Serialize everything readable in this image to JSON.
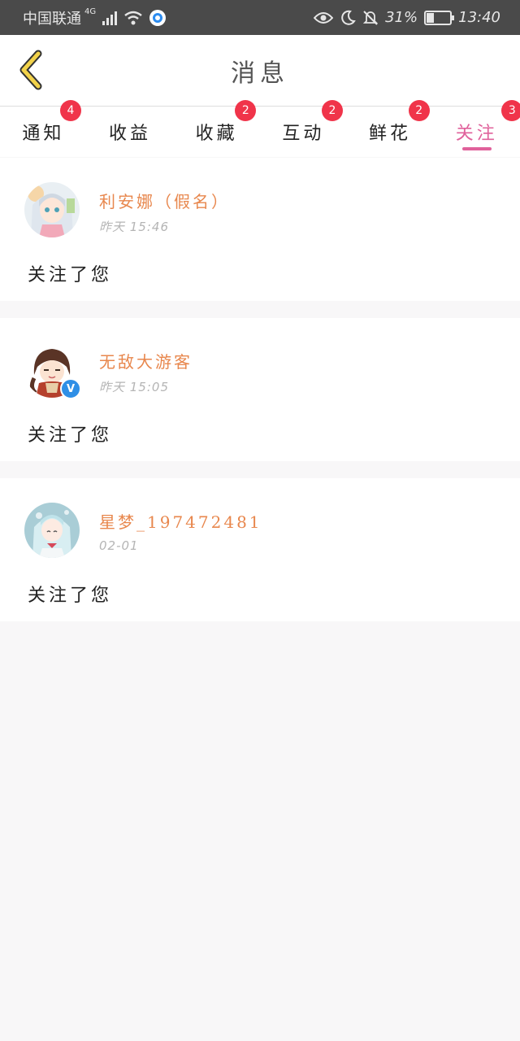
{
  "status_bar": {
    "carrier": "中国联通",
    "network": "4G",
    "battery_percent": "31%",
    "battery_level": 0.31,
    "time": "13:40",
    "icons": [
      "signal-icon",
      "wifi-icon",
      "app-icon",
      "eye-icon",
      "moon-icon",
      "mute-icon",
      "battery-icon"
    ]
  },
  "header": {
    "title": "消息",
    "back_icon": "chevron-left-icon"
  },
  "tabs": [
    {
      "label": "通知",
      "badge": "4"
    },
    {
      "label": "收益",
      "badge": ""
    },
    {
      "label": "收藏",
      "badge": "2"
    },
    {
      "label": "互动",
      "badge": "2"
    },
    {
      "label": "鲜花",
      "badge": "2"
    },
    {
      "label": "关注",
      "badge": "3",
      "active": true
    }
  ],
  "colors": {
    "accent": "#e0619b",
    "name": "#e8874d",
    "badge": "#f0344a",
    "back_arrow": "#f2d24a"
  },
  "messages": [
    {
      "name": "利安娜（假名）",
      "time": "昨天  15:46",
      "text": "关注了您",
      "verified": false
    },
    {
      "name": "无敌大游客",
      "time": "昨天  15:05",
      "text": "关注了您",
      "verified": true
    },
    {
      "name": "星梦_197472481",
      "time": "02-01",
      "text": "关注了您",
      "verified": false
    }
  ]
}
